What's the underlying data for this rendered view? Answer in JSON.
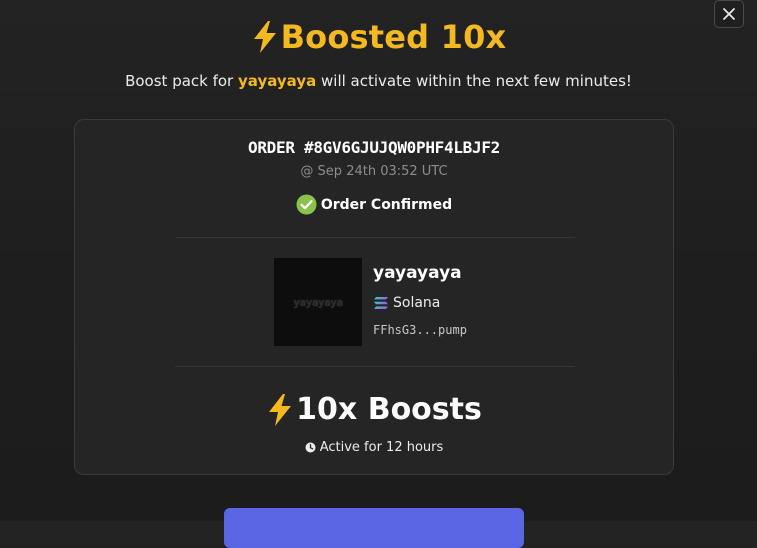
{
  "modal": {
    "close_icon": "close-icon"
  },
  "header": {
    "title": "Boosted 10x",
    "icon": "lightning-bolt-icon",
    "accent_color": "#f5b920"
  },
  "subtitle": {
    "prefix": "Boost pack for",
    "token": "yayayaya",
    "suffix": "will activate within the next few minutes!"
  },
  "order": {
    "id": "ORDER #8GV6GJUJQW0PHF4LBJF2",
    "timestamp": "@ Sep 24th 03:52 UTC",
    "status": "Order Confirmed",
    "status_icon": "check-circle-icon",
    "status_color": "#8bc34a"
  },
  "token": {
    "name": "yayayaya",
    "image_text": "yayayaya",
    "chain": "Solana",
    "chain_icon": "solana-icon",
    "address": "FFhsG3...pump"
  },
  "boost": {
    "label": "10x Boosts",
    "icon": "lightning-bolt-icon",
    "duration": "Active for 12 hours",
    "duration_icon": "clock-icon"
  },
  "cta": {
    "color": "#5b66e4"
  }
}
